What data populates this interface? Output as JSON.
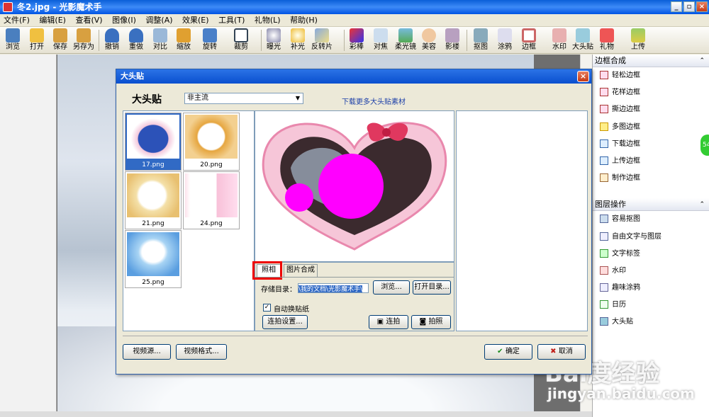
{
  "window": {
    "title": "冬2.jpg - 光影魔术手"
  },
  "menu": [
    "文件(F)",
    "编辑(E)",
    "查看(V)",
    "图像(I)",
    "调整(A)",
    "效果(E)",
    "工具(T)",
    "礼物(L)",
    "帮助(H)"
  ],
  "toolbar": [
    "浏览",
    "打开",
    "保存",
    "另存为",
    "撤销",
    "重做",
    "对比",
    "缩放",
    "旋转",
    "裁剪",
    "曝光",
    "补光",
    "反转片",
    "彩棒",
    "对焦",
    "柔光镜",
    "美容",
    "影楼",
    "抠图",
    "涂鸦",
    "边框",
    "水印",
    "大头贴",
    "礼物",
    "上传"
  ],
  "right_panel": {
    "border_section": {
      "title": "边框合成",
      "items": [
        "轻松边框",
        "花样边框",
        "撕边边框",
        "多图边框",
        "下载边框",
        "上传边框",
        "制作边框"
      ]
    },
    "layer_section": {
      "title": "图层操作",
      "items": [
        "容易抠图",
        "自由文字与图层",
        "文字标签",
        "水印",
        "趣味涂鸦",
        "日历",
        "大头贴"
      ]
    }
  },
  "side_badge": "54",
  "dialog": {
    "title": "大头贴",
    "heading": "大头贴",
    "category": "非主流",
    "download_link": "下载更多大头贴素材",
    "thumbnails": [
      "17.png",
      "20.png",
      "21.png",
      "24.png",
      "25.png"
    ],
    "tabs": {
      "photo": "照相",
      "compose": "图片合成"
    },
    "save_dir_label": "存储目录：",
    "save_dir_value": "\\我的文档\\光影魔术手\\",
    "browse_button": "浏览...",
    "open_dir_button": "打开目录...",
    "auto_sticker_label": "自动换贴纸",
    "auto_sticker_checked": true,
    "burst_settings_button": "连拍设置...",
    "burst_button": "连拍",
    "shoot_button": "拍照",
    "video_source_button": "视频源...",
    "video_format_button": "视频格式...",
    "ok_button": "确定",
    "cancel_button": "取消"
  },
  "watermark": {
    "brand": "Bai度经验",
    "url": "jingyan.baidu.com"
  }
}
